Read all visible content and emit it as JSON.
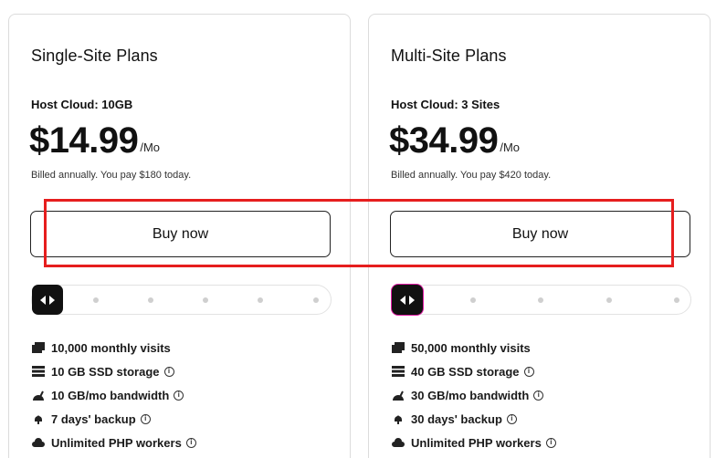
{
  "plans": [
    {
      "title": "Single-Site Plans",
      "subtitle": "Host Cloud: 10GB",
      "price": "$14.99",
      "period": "/Mo",
      "billing": "Billed annually. You pay $180 today.",
      "button": "Buy now",
      "slider_position": 0,
      "features": [
        {
          "text": "10,000 monthly visits",
          "icon": "visits-icon",
          "info": false
        },
        {
          "text": "10 GB SSD storage",
          "icon": "storage-icon",
          "info": true
        },
        {
          "text": "10 GB/mo bandwidth",
          "icon": "bandwidth-icon",
          "info": true
        },
        {
          "text": "7 days' backup",
          "icon": "backup-icon",
          "info": true
        },
        {
          "text": "Unlimited PHP workers",
          "icon": "cloud-icon",
          "info": true
        }
      ]
    },
    {
      "title": "Multi-Site Plans",
      "subtitle": "Host Cloud: 3 Sites",
      "price": "$34.99",
      "period": "/Mo",
      "billing": "Billed annually. You pay $420 today.",
      "button": "Buy now",
      "slider_position": 0,
      "features": [
        {
          "text": "50,000 monthly visits",
          "icon": "visits-icon",
          "info": false
        },
        {
          "text": "40 GB SSD storage",
          "icon": "storage-icon",
          "info": true
        },
        {
          "text": "30 GB/mo bandwidth",
          "icon": "bandwidth-icon",
          "info": true
        },
        {
          "text": "30 days' backup",
          "icon": "backup-icon",
          "info": true
        },
        {
          "text": "Unlimited PHP workers",
          "icon": "cloud-icon",
          "info": true
        }
      ]
    }
  ],
  "info_glyph": "i",
  "colors": {
    "highlight": "#e61e1e",
    "handle": "#111111",
    "handle_focus": "#e11ba5"
  }
}
